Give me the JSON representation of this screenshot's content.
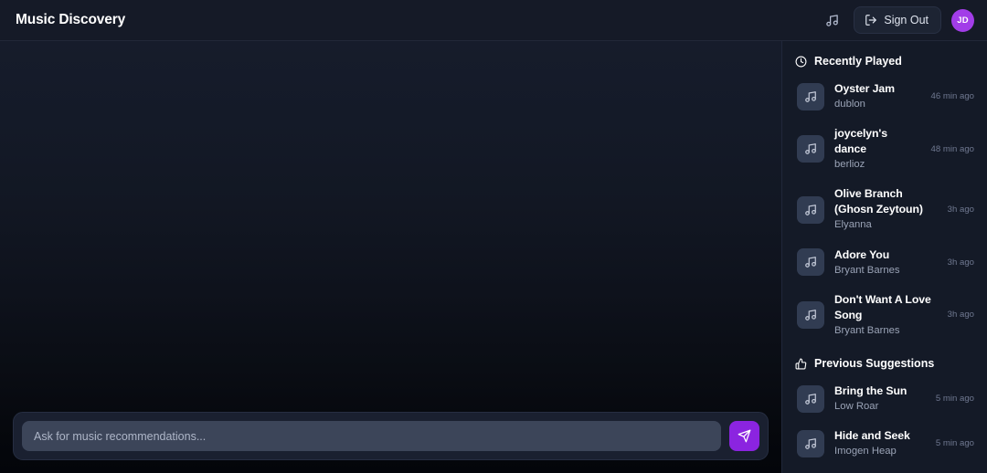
{
  "header": {
    "title": "Music Discovery",
    "music_icon": "music-note-icon",
    "signout_label": "Sign Out",
    "signout_icon": "logout-icon",
    "avatar_initials": "JD",
    "avatar_color": "#a23de8"
  },
  "chat": {
    "placeholder": "Ask for music recommendations...",
    "input_value": "",
    "send_icon": "send-paper-plane-icon",
    "send_color": "#8b24e0",
    "messages": []
  },
  "sidebar": {
    "sections": [
      {
        "title": "Recently Played",
        "icon": "clock-icon",
        "tracks": [
          {
            "title": "Oyster Jam",
            "artist": "dublon",
            "time": "46 min ago"
          },
          {
            "title": "joycelyn's dance",
            "artist": "berlioz",
            "time": "48 min ago"
          },
          {
            "title": "Olive Branch (Ghosn Zeytoun)",
            "artist": "Elyanna",
            "time": "3h ago"
          },
          {
            "title": "Adore You",
            "artist": "Bryant Barnes",
            "time": "3h ago"
          },
          {
            "title": "Don't Want A Love Song",
            "artist": "Bryant Barnes",
            "time": "3h ago"
          }
        ]
      },
      {
        "title": "Previous Suggestions",
        "icon": "thumbs-up-icon",
        "tracks": [
          {
            "title": "Bring the Sun",
            "artist": "Low Roar",
            "time": "5 min ago"
          },
          {
            "title": "Hide and Seek",
            "artist": "Imogen Heap",
            "time": "5 min ago"
          }
        ]
      }
    ]
  }
}
